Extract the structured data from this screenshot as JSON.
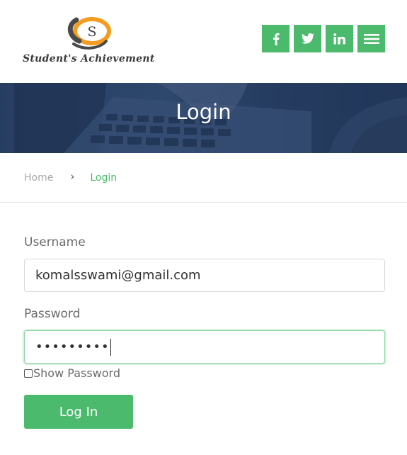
{
  "brand": {
    "logo_letter": "S",
    "name": "Student's Achievement",
    "accent_color": "#4cba6d",
    "logo_ring_color": "#f39c1f"
  },
  "social": [
    {
      "name": "facebook-icon",
      "glyph": "f"
    },
    {
      "name": "twitter-icon",
      "glyph": "twitter"
    },
    {
      "name": "linkedin-icon",
      "glyph": "in"
    },
    {
      "name": "menu-icon",
      "glyph": "hamburger"
    }
  ],
  "banner": {
    "title": "Login"
  },
  "breadcrumb": {
    "home": "Home",
    "separator": "›",
    "current": "Login"
  },
  "form": {
    "username_label": "Username",
    "username_value": "komalsswami@gmail.com",
    "password_label": "Password",
    "password_mask": "•••••••••",
    "show_password_label": "Show Password",
    "show_password_checked": false,
    "submit_label": "Log In"
  }
}
